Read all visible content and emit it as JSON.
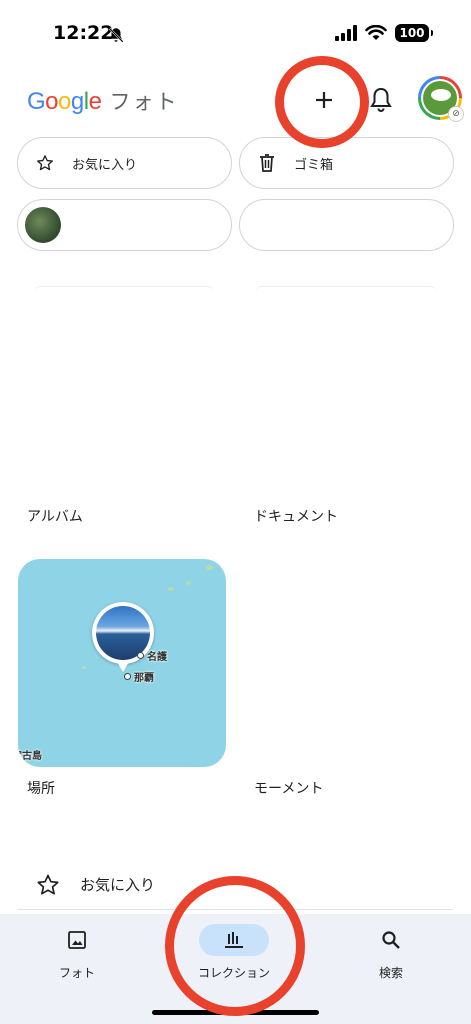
{
  "status_bar": {
    "time": "12:22",
    "battery": "100",
    "icons": [
      "bell-muted-icon",
      "signal-icon",
      "wifi-icon",
      "battery-icon"
    ]
  },
  "header": {
    "logo_letters": [
      "G",
      "o",
      "o",
      "g",
      "l",
      "e"
    ],
    "logo_suffix": "フォト",
    "icons": [
      "plus-icon",
      "bell-icon",
      "avatar"
    ]
  },
  "chips": [
    {
      "label": "お気に入り",
      "icon": "star-icon"
    },
    {
      "label": "ゴミ箱",
      "icon": "trash-icon"
    },
    {
      "label": "",
      "icon": "person-thumbnail"
    },
    {
      "label": "",
      "icon": ""
    }
  ],
  "sections": {
    "albums": "アルバム",
    "documents": "ドキュメント",
    "places": "場所",
    "moments": "モーメント"
  },
  "map": {
    "places": [
      "名護",
      "那覇",
      "宮古島"
    ]
  },
  "favorites_row": {
    "label": "お気に入り",
    "icon": "star-icon"
  },
  "bottom_nav": {
    "tabs": [
      {
        "label": "フォト",
        "icon": "photo-icon",
        "active": false
      },
      {
        "label": "コレクション",
        "icon": "collection-icon",
        "active": true
      },
      {
        "label": "検索",
        "icon": "search-icon",
        "active": false
      }
    ]
  },
  "colors": {
    "annotation": "#e8412c",
    "nav_background": "#eef1f7",
    "active_pill": "#c8e2fb",
    "map_water": "#8ed3e6"
  }
}
